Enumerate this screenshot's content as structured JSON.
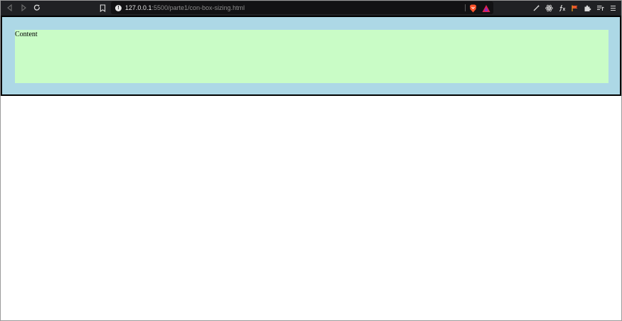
{
  "browser": {
    "url_host": "127.0.0.1",
    "url_rest": ":5500/parte1/con-box-sizing.html",
    "icons": {
      "back": "back-icon",
      "forward": "forward-icon",
      "reload": "reload-icon",
      "bookmark": "bookmark-icon",
      "site_info": "info-icon",
      "shields": "brave-shield-icon",
      "rewards": "brave-rewards-icon"
    },
    "extensions": [
      "wand-icon",
      "react-icon",
      "function-icon",
      "flag-icon",
      "puzzle-icon",
      "playlist-icon",
      "menu-icon"
    ],
    "colors": {
      "toolbar": "#202124",
      "urlbar": "#121214"
    }
  },
  "page": {
    "content_label": "Content",
    "colors": {
      "outer": "#add8e6",
      "inner": "#c9fcc6",
      "border": "#000000"
    }
  }
}
